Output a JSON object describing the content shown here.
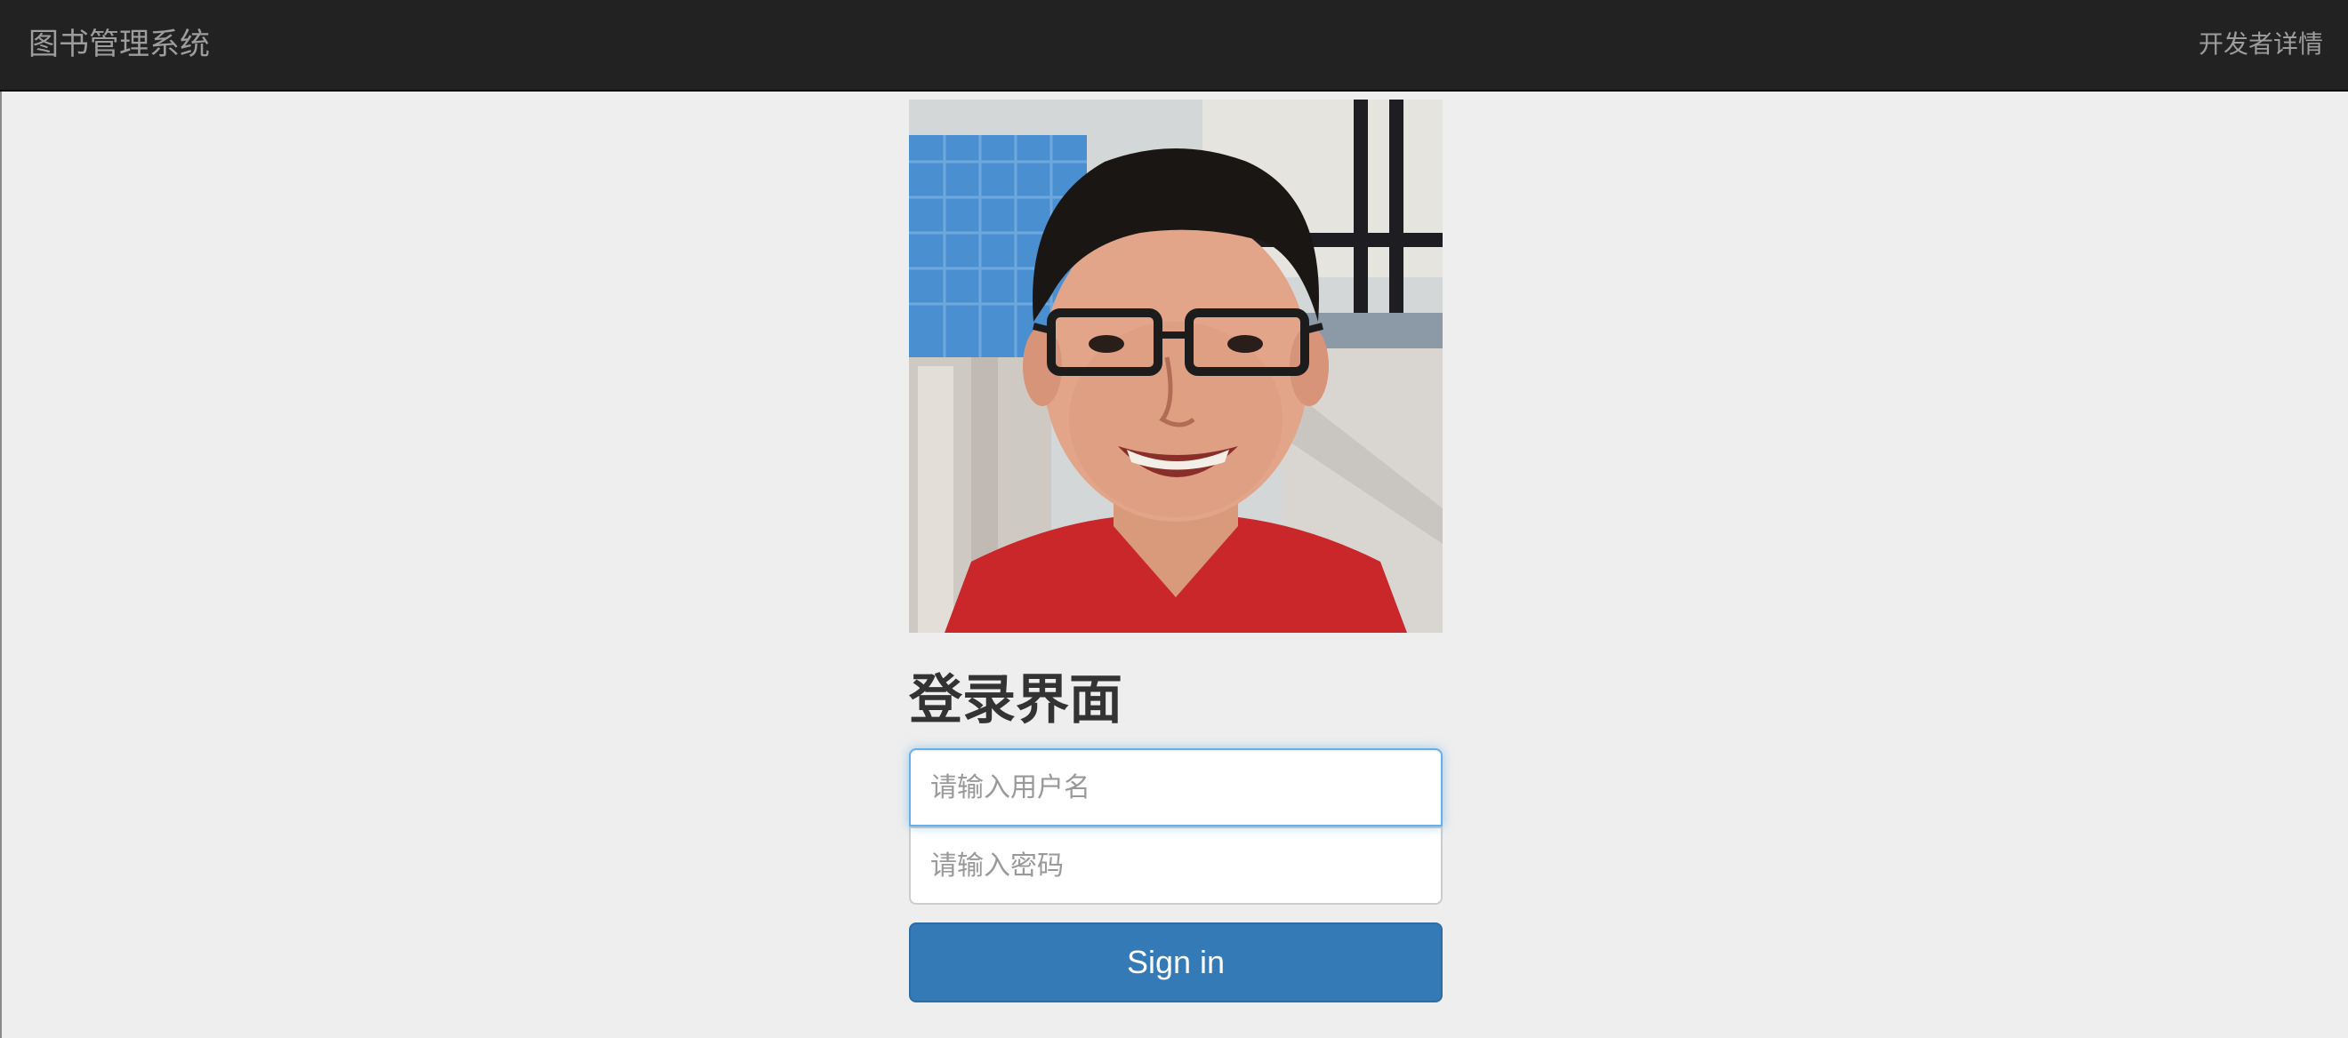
{
  "navbar": {
    "brand": "图书管理系统",
    "developer_link": "开发者详情"
  },
  "login": {
    "photo_alt": "developer-photo",
    "heading": "登录界面",
    "username_placeholder": "请输入用户名",
    "password_placeholder": "请输入密码",
    "signin_label": "Sign in"
  },
  "colors": {
    "navbar_bg": "#222222",
    "page_bg": "#eeeeee",
    "primary_button": "#337ab7",
    "focus_border": "#66afe9"
  }
}
